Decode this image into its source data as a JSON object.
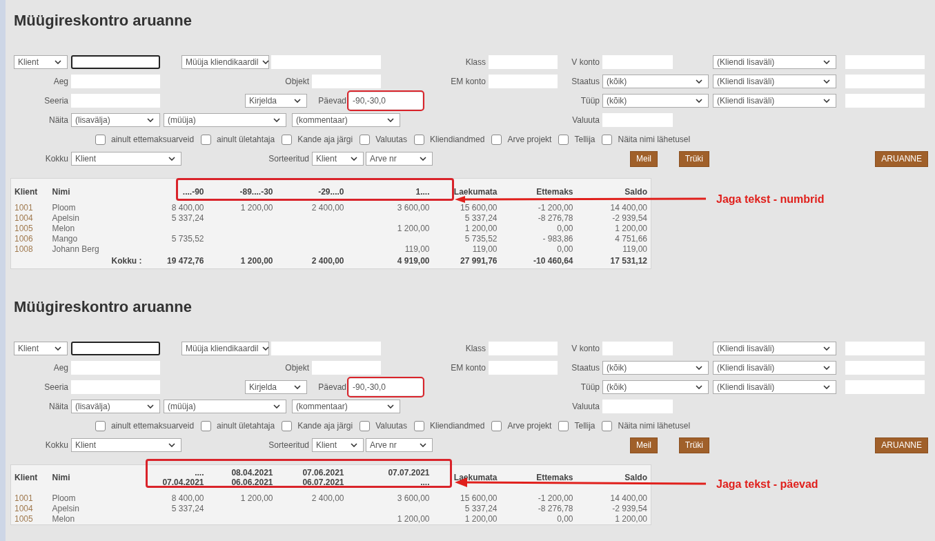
{
  "panels": [
    {
      "title": "Müügireskontro aruanne",
      "form": [
        [
          {
            "kind": "select",
            "value": "Klient"
          },
          {
            "kind": "input",
            "focused": true
          },
          {
            "kind": "select",
            "value": "Müüja kliendikaardil"
          },
          {
            "kind": "input",
            "focused": false
          },
          {
            "kind": "label",
            "text": "Klass"
          },
          {
            "kind": "input",
            "focused": false
          },
          {
            "kind": "label",
            "text": "V konto"
          },
          {
            "kind": "input",
            "focused": false
          },
          {
            "kind": "select",
            "value": "(Kliendi lisaväli)"
          },
          {
            "kind": "input",
            "focused": false
          }
        ],
        [
          {
            "kind": "label",
            "text": "Aeg"
          },
          {
            "kind": "input",
            "focused": false
          },
          {
            "kind": "label",
            "text": "Objekt"
          },
          {
            "kind": "input",
            "focused": false
          },
          {
            "kind": "label",
            "text": "EM konto"
          },
          {
            "kind": "input",
            "focused": false
          },
          {
            "kind": "label",
            "text": "Staatus"
          },
          {
            "kind": "select",
            "value": "(kõik)"
          },
          {
            "kind": "select",
            "value": "(Kliendi lisaväli)"
          },
          {
            "kind": "input",
            "focused": false
          }
        ],
        [
          {
            "kind": "label",
            "text": "Seeria"
          },
          {
            "kind": "input",
            "focused": false
          },
          {
            "kind": "select",
            "value": "Kirjelda"
          },
          {
            "kind": "label",
            "text": "Päevad"
          },
          {
            "kind": "input",
            "focused": false,
            "value": "-90,-30,0"
          },
          {
            "kind": "label",
            "text": "Tüüp"
          },
          {
            "kind": "select",
            "value": "(kõik)"
          },
          {
            "kind": "select",
            "value": "(Kliendi lisaväli)"
          },
          {
            "kind": "input",
            "focused": false
          }
        ],
        [
          {
            "kind": "label",
            "text": "Näita"
          },
          {
            "kind": "select",
            "value": "(lisavälja)"
          },
          {
            "kind": "select",
            "value": "(müüja)"
          },
          {
            "kind": "select",
            "value": "(kommentaar)"
          },
          {
            "kind": "label",
            "text": "Valuuta"
          },
          {
            "kind": "input",
            "focused": false
          }
        ],
        [
          {
            "kind": "checks",
            "items": [
              {
                "label": "ainult ettemaksuarveid",
                "checked": false
              },
              {
                "label": "ainult ületahtaja",
                "checked": false
              },
              {
                "label": "Kande aja järgi",
                "checked": false
              },
              {
                "label": "Valuutas",
                "checked": false
              },
              {
                "label": "Kliendiandmed",
                "checked": false
              },
              {
                "label": "Arve projekt",
                "checked": false
              },
              {
                "label": "Tellija",
                "checked": false
              },
              {
                "label": "Näita nimi lähetusel",
                "checked": false
              }
            ]
          }
        ],
        [
          {
            "kind": "label",
            "text": "Kokku"
          },
          {
            "kind": "select",
            "value": "Klient"
          },
          {
            "kind": "label",
            "text": "Sorteeritud"
          },
          {
            "kind": "select",
            "value": "Klient"
          },
          {
            "kind": "select",
            "value": "Arve nr"
          },
          {
            "kind": "button",
            "text": "Meil"
          },
          {
            "kind": "button",
            "text": "Trüki"
          },
          {
            "kind": "button",
            "text": "ARUANNE"
          }
        ]
      ],
      "table": {
        "columns": [
          {
            "lines": [
              "Klient"
            ]
          },
          {
            "lines": [
              "Nimi"
            ]
          },
          {
            "lines": [
              "....-90"
            ]
          },
          {
            "lines": [
              "-89....-30"
            ]
          },
          {
            "lines": [
              "-29....0"
            ]
          },
          {
            "lines": [
              "1...."
            ]
          },
          {
            "lines": [
              "Laekumata"
            ]
          },
          {
            "lines": [
              "Ettemaks"
            ]
          },
          {
            "lines": [
              "Saldo"
            ]
          }
        ],
        "rows": [
          [
            "1001",
            "Ploom",
            "8 400,00",
            "1 200,00",
            "2 400,00",
            "3 600,00",
            "15 600,00",
            "-1 200,00",
            "14 400,00"
          ],
          [
            "1004",
            "Apelsin",
            "5 337,24",
            null,
            null,
            null,
            "5 337,24",
            "-8 276,78",
            "-2 939,54"
          ],
          [
            "1005",
            "Melon",
            null,
            null,
            null,
            "1 200,00",
            "1 200,00",
            "0,00",
            "1 200,00"
          ],
          [
            "1006",
            "Mango",
            "5 735,52",
            null,
            null,
            null,
            "5 735,52",
            "- 983,86",
            "4 751,66"
          ],
          [
            "1008",
            "Johann Berg",
            null,
            null,
            null,
            "119,00",
            "119,00",
            "0,00",
            "119,00"
          ]
        ],
        "total": {
          "label": "Kokku :",
          "values": [
            "19 472,76",
            "1 200,00",
            "2 400,00",
            "4 919,00",
            "27 991,76",
            "-10 460,64",
            "17 531,12"
          ]
        }
      },
      "annotation": "Jaga tekst - numbrid"
    },
    {
      "title": "Müügireskontro aruanne",
      "form": [
        [
          {
            "kind": "select",
            "value": "Klient"
          },
          {
            "kind": "input",
            "focused": true
          },
          {
            "kind": "select",
            "value": "Müüja kliendikaardil"
          },
          {
            "kind": "input",
            "focused": false
          },
          {
            "kind": "label",
            "text": "Klass"
          },
          {
            "kind": "input",
            "focused": false
          },
          {
            "kind": "label",
            "text": "V konto"
          },
          {
            "kind": "input",
            "focused": false
          },
          {
            "kind": "select",
            "value": "(Kliendi lisaväli)"
          },
          {
            "kind": "input",
            "focused": false
          }
        ],
        [
          {
            "kind": "label",
            "text": "Aeg"
          },
          {
            "kind": "input",
            "focused": false
          },
          {
            "kind": "label",
            "text": "Objekt"
          },
          {
            "kind": "input",
            "focused": false
          },
          {
            "kind": "label",
            "text": "EM konto"
          },
          {
            "kind": "input",
            "focused": false
          },
          {
            "kind": "label",
            "text": "Staatus"
          },
          {
            "kind": "select",
            "value": "(kõik)"
          },
          {
            "kind": "select",
            "value": "(Kliendi lisaväli)"
          },
          {
            "kind": "input",
            "focused": false
          }
        ],
        [
          {
            "kind": "label",
            "text": "Seeria"
          },
          {
            "kind": "input",
            "focused": false
          },
          {
            "kind": "select",
            "value": "Kirjelda"
          },
          {
            "kind": "label",
            "text": "Päevad"
          },
          {
            "kind": "input",
            "focused": false,
            "value": "-90,-30,0"
          },
          {
            "kind": "label",
            "text": "Tüüp"
          },
          {
            "kind": "select",
            "value": "(kõik)"
          },
          {
            "kind": "select",
            "value": "(Kliendi lisaväli)"
          },
          {
            "kind": "input",
            "focused": false
          }
        ],
        [
          {
            "kind": "label",
            "text": "Näita"
          },
          {
            "kind": "select",
            "value": "(lisavälja)"
          },
          {
            "kind": "select",
            "value": "(müüja)"
          },
          {
            "kind": "select",
            "value": "(kommentaar)"
          },
          {
            "kind": "label",
            "text": "Valuuta"
          },
          {
            "kind": "input",
            "focused": false
          }
        ],
        [
          {
            "kind": "checks",
            "items": [
              {
                "label": "ainult ettemaksuarveid",
                "checked": false
              },
              {
                "label": "ainult ületahtaja",
                "checked": false
              },
              {
                "label": "Kande aja järgi",
                "checked": false
              },
              {
                "label": "Valuutas",
                "checked": false
              },
              {
                "label": "Kliendiandmed",
                "checked": false
              },
              {
                "label": "Arve projekt",
                "checked": false
              },
              {
                "label": "Tellija",
                "checked": false
              },
              {
                "label": "Näita nimi lähetusel",
                "checked": false
              }
            ]
          }
        ],
        [
          {
            "kind": "label",
            "text": "Kokku"
          },
          {
            "kind": "select",
            "value": "Klient"
          },
          {
            "kind": "label",
            "text": "Sorteeritud"
          },
          {
            "kind": "select",
            "value": "Klient"
          },
          {
            "kind": "select",
            "value": "Arve nr"
          },
          {
            "kind": "button",
            "text": "Meil"
          },
          {
            "kind": "button",
            "text": "Trüki"
          },
          {
            "kind": "button",
            "text": "ARUANNE"
          }
        ]
      ],
      "table": {
        "columns": [
          {
            "lines": [
              "Klient"
            ]
          },
          {
            "lines": [
              "Nimi"
            ]
          },
          {
            "lines": [
              "....",
              "07.04.2021"
            ]
          },
          {
            "lines": [
              "08.04.2021",
              "06.06.2021"
            ]
          },
          {
            "lines": [
              "07.06.2021",
              "06.07.2021"
            ]
          },
          {
            "lines": [
              "07.07.2021",
              "...."
            ]
          },
          {
            "lines": [
              "Laekumata"
            ]
          },
          {
            "lines": [
              "Ettemaks"
            ]
          },
          {
            "lines": [
              "Saldo"
            ]
          }
        ],
        "rows": [
          [
            "1001",
            "Ploom",
            "8 400,00",
            "1 200,00",
            "2 400,00",
            "3 600,00",
            "15 600,00",
            "-1 200,00",
            "14 400,00"
          ],
          [
            "1004",
            "Apelsin",
            "5 337,24",
            null,
            null,
            null,
            "5 337,24",
            "-8 276,78",
            "-2 939,54"
          ],
          [
            "1005",
            "Melon",
            null,
            null,
            null,
            "1 200,00",
            "1 200,00",
            "0,00",
            "1 200,00"
          ]
        ]
      },
      "annotation": "Jaga tekst - päevad"
    }
  ]
}
